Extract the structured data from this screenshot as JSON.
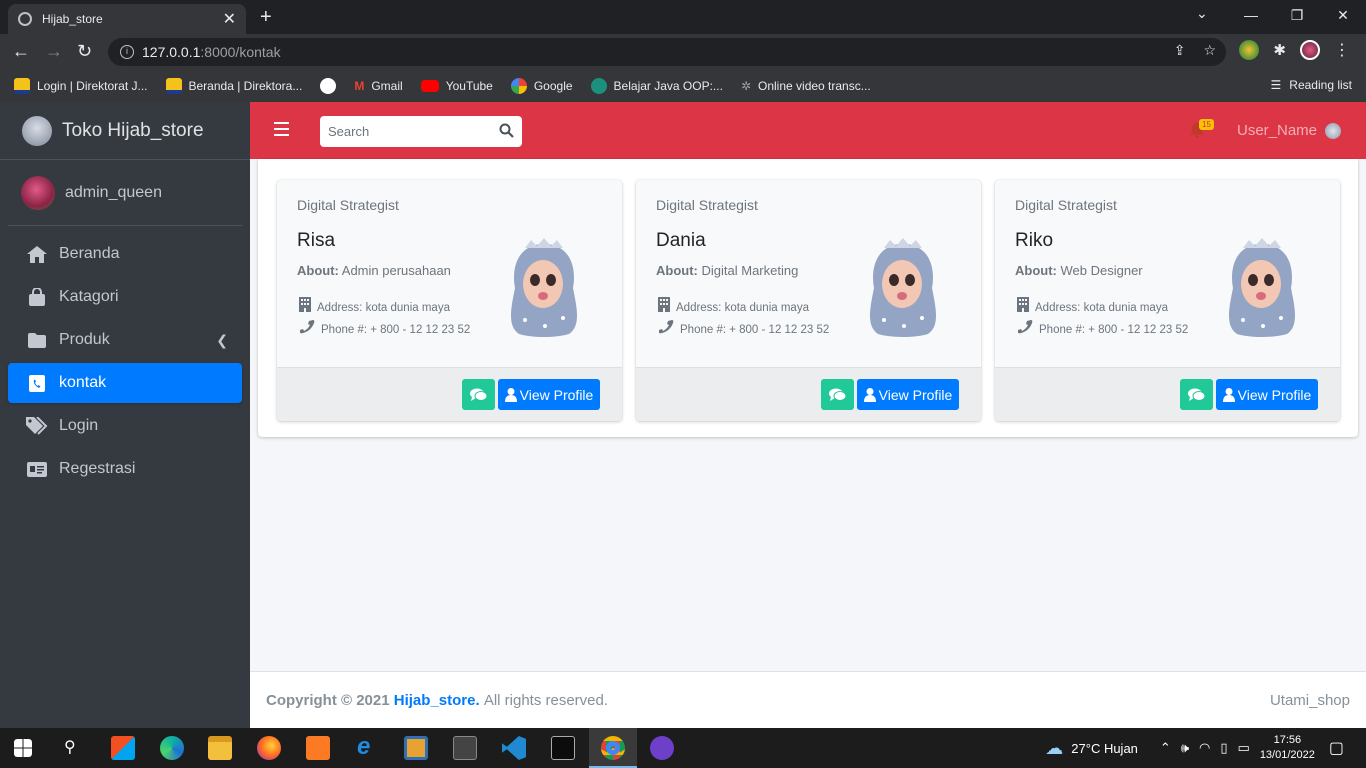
{
  "browser": {
    "tab_title": "Hijab_store",
    "url_host": "127.0.0.1",
    "url_path": ":8000/kontak",
    "bookmarks": [
      "Login | Direktorat J...",
      "Beranda | Direktora...",
      "",
      "Gmail",
      "YouTube",
      "Google",
      "Belajar Java OOP:...",
      "Online video transc..."
    ],
    "reading_list": "Reading list"
  },
  "brand": {
    "name": "Toko Hijab_store"
  },
  "user": {
    "name": "admin_queen"
  },
  "menu": [
    {
      "label": "Beranda",
      "icon": "home-icon"
    },
    {
      "label": "Katagori",
      "icon": "shopping-bag-icon"
    },
    {
      "label": "Produk",
      "icon": "folder-icon"
    },
    {
      "label": "kontak",
      "icon": "contact-book-icon"
    },
    {
      "label": "Login",
      "icon": "tags-icon"
    },
    {
      "label": "Regestrasi",
      "icon": "id-card-icon"
    }
  ],
  "navbar": {
    "search_placeholder": "Search",
    "notif_count": "15",
    "username": "User_Name"
  },
  "contacts": [
    {
      "role": "Digital Strategist",
      "name": "Risa",
      "about_label": "About:",
      "about": "Admin perusahaan",
      "address": "Address: kota dunia maya",
      "phone": "Phone #: + 800 - 12 12 23 52",
      "view_label": "View Profile"
    },
    {
      "role": "Digital Strategist",
      "name": "Dania",
      "about_label": "About:",
      "about": "Digital Marketing",
      "address": "Address: kota dunia maya",
      "phone": "Phone #: + 800 - 12 12 23 52",
      "view_label": "View Profile"
    },
    {
      "role": "Digital Strategist",
      "name": "Riko",
      "about_label": "About:",
      "about": "Web Designer",
      "address": "Address: kota dunia maya",
      "phone": "Phone #: + 800 - 12 12 23 52",
      "view_label": "View Profile"
    }
  ],
  "footer": {
    "copyright": "Copyright © 2021",
    "brand": "Hijab_store.",
    "rights": "All rights reserved.",
    "right_text": "Utami_shop"
  },
  "taskbar": {
    "weather": "27°C  Hujan",
    "time": "17:56",
    "date": "13/01/2022"
  }
}
